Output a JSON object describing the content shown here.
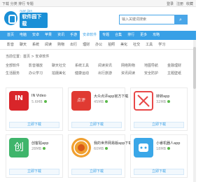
{
  "topbar": {
    "left_text": "下载 分类 排行 专题",
    "links": [
      "登录",
      "注册",
      "收藏"
    ]
  },
  "logo": {
    "small_text": "ruan jian",
    "main_text": "软件园下载"
  },
  "search": {
    "placeholder": "输入关键词搜索",
    "button_icon": "search-icon"
  },
  "nav": {
    "items": [
      "首页",
      "电脑",
      "安卓",
      "苹果",
      "资讯",
      "手游",
      "安卓软件",
      "专题",
      "合集",
      "排行",
      "更多",
      "攻略"
    ],
    "active_index": 6
  },
  "subnav": {
    "items": [
      "影音",
      "聊天",
      "系统",
      "阅读",
      "购物",
      "出行",
      "理财",
      "办公",
      "拍照",
      "美化",
      "社交",
      "工具",
      "学习"
    ]
  },
  "breadcrumb": "当前位置：首页 > 安卓软件",
  "tags": [
    "全部软件",
    "影音播放",
    "聊天社交",
    "系统工具",
    "阅读资讯",
    "网络购物",
    "地图导航",
    "金融理财",
    "生活服务",
    "办公学习",
    "拍摄美化",
    "健康运动",
    "出行旅游",
    "资讯阅读",
    "安全防护",
    "主题壁纸"
  ],
  "cards": [
    {
      "name": "IN Video",
      "meta": "5.6MB",
      "button": "立即下载",
      "icon": "in-logo-icon",
      "icon_text": "IN"
    },
    {
      "name": "大众点评app官方下载",
      "meta": "45MB",
      "button": "立即下载",
      "icon": "dianping-logo-icon",
      "icon_text": "点评"
    },
    {
      "name": "转转app",
      "meta": "32MB",
      "button": "立即下载",
      "icon": "blocked-logo-icon",
      "icon_text": ""
    },
    {
      "name": "创客贴app",
      "meta": "28MB",
      "button": "立即下载",
      "icon": "chuang-logo-icon",
      "icon_text": "创"
    },
    {
      "name": "我的世界网易版app下载",
      "meta": "60MB",
      "button": "立即下载",
      "icon": "seal-logo-icon",
      "icon_text": ""
    },
    {
      "name": "小睿机器人app",
      "meta": "18MB",
      "button": "立即下载",
      "icon": "robot-logo-icon",
      "icon_text": ""
    }
  ]
}
